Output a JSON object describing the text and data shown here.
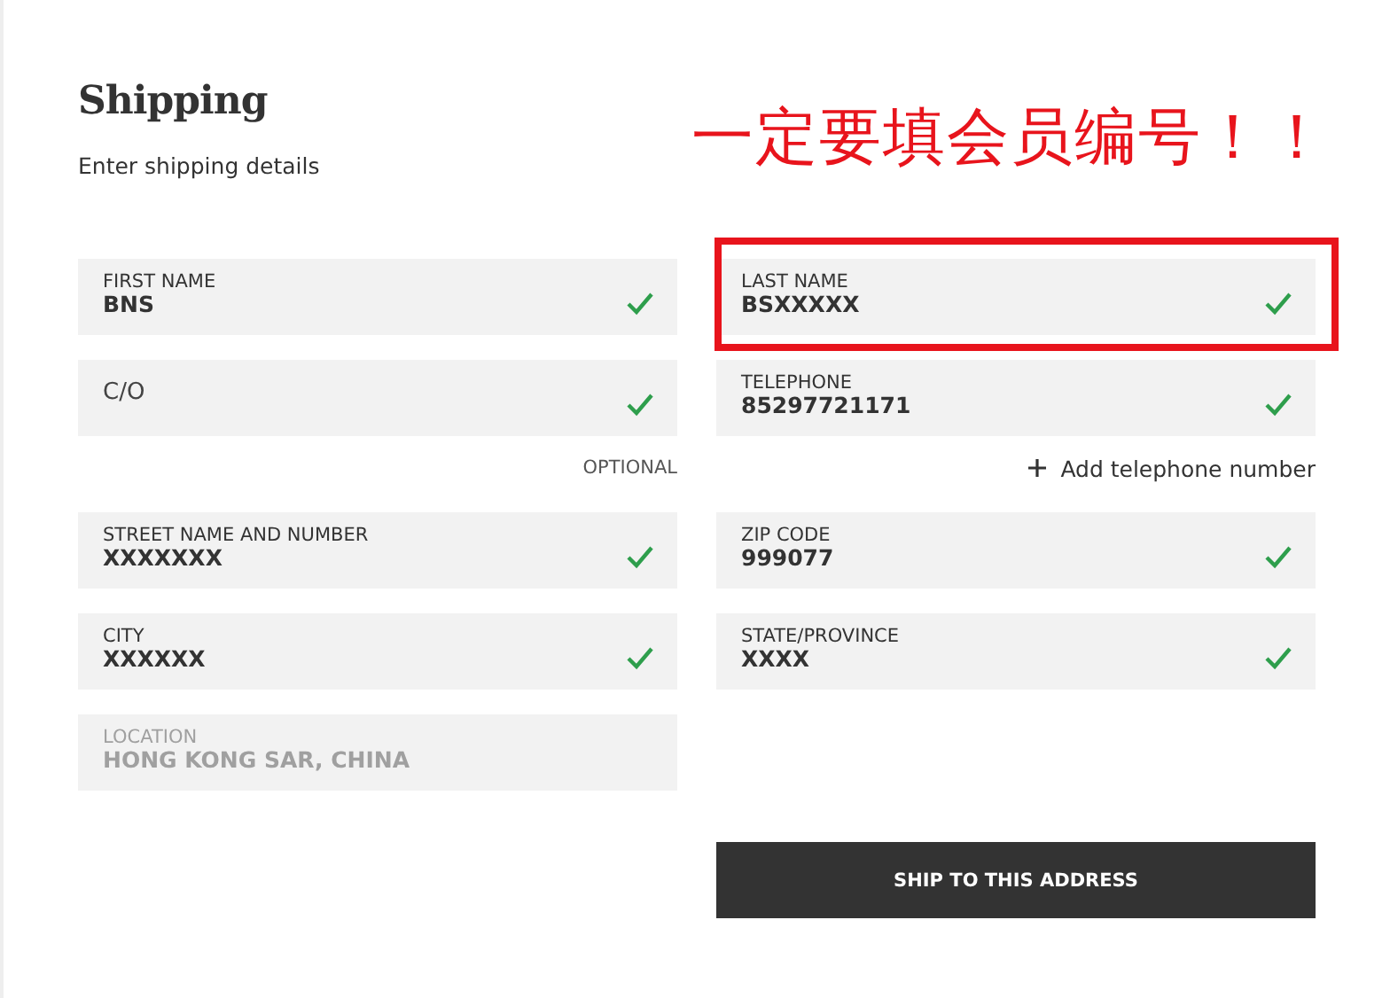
{
  "header": {
    "title": "Shipping",
    "subtitle": "Enter shipping details"
  },
  "annotation": {
    "text": "一定要填会员编号！！"
  },
  "items": [
    {
      "kind": "field",
      "label": "FIRST NAME",
      "value": "BNS",
      "valid": true,
      "disabled": false,
      "highlighted": false
    },
    {
      "kind": "field",
      "label": "LAST NAME",
      "value": "BSXXXXX",
      "valid": true,
      "disabled": false,
      "highlighted": true
    },
    {
      "kind": "field",
      "placeholder": "C/O",
      "valid": true,
      "disabled": false,
      "highlighted": false
    },
    {
      "kind": "field",
      "label": "TELEPHONE",
      "value": "85297721171",
      "valid": true,
      "disabled": false,
      "highlighted": false
    },
    {
      "kind": "note",
      "text": "OPTIONAL"
    },
    {
      "kind": "link",
      "text": "Add telephone number"
    },
    {
      "kind": "field",
      "label": "STREET NAME AND NUMBER",
      "value": "XXXXXXX",
      "valid": true,
      "disabled": false,
      "highlighted": false
    },
    {
      "kind": "field",
      "label": "ZIP CODE",
      "value": "999077",
      "valid": true,
      "disabled": false,
      "highlighted": false
    },
    {
      "kind": "field",
      "label": "CITY",
      "value": "XXXXXX",
      "valid": true,
      "disabled": false,
      "highlighted": false
    },
    {
      "kind": "field",
      "label": "STATE/PROVINCE",
      "value": "XXXX",
      "valid": true,
      "disabled": false,
      "highlighted": false
    },
    {
      "kind": "field",
      "label": "LOCATION",
      "value": "HONG KONG SAR, CHINA",
      "valid": false,
      "disabled": true,
      "highlighted": false
    },
    {
      "kind": "blank"
    },
    {
      "kind": "blank"
    },
    {
      "kind": "button",
      "text": "SHIP TO THIS ADDRESS"
    }
  ]
}
